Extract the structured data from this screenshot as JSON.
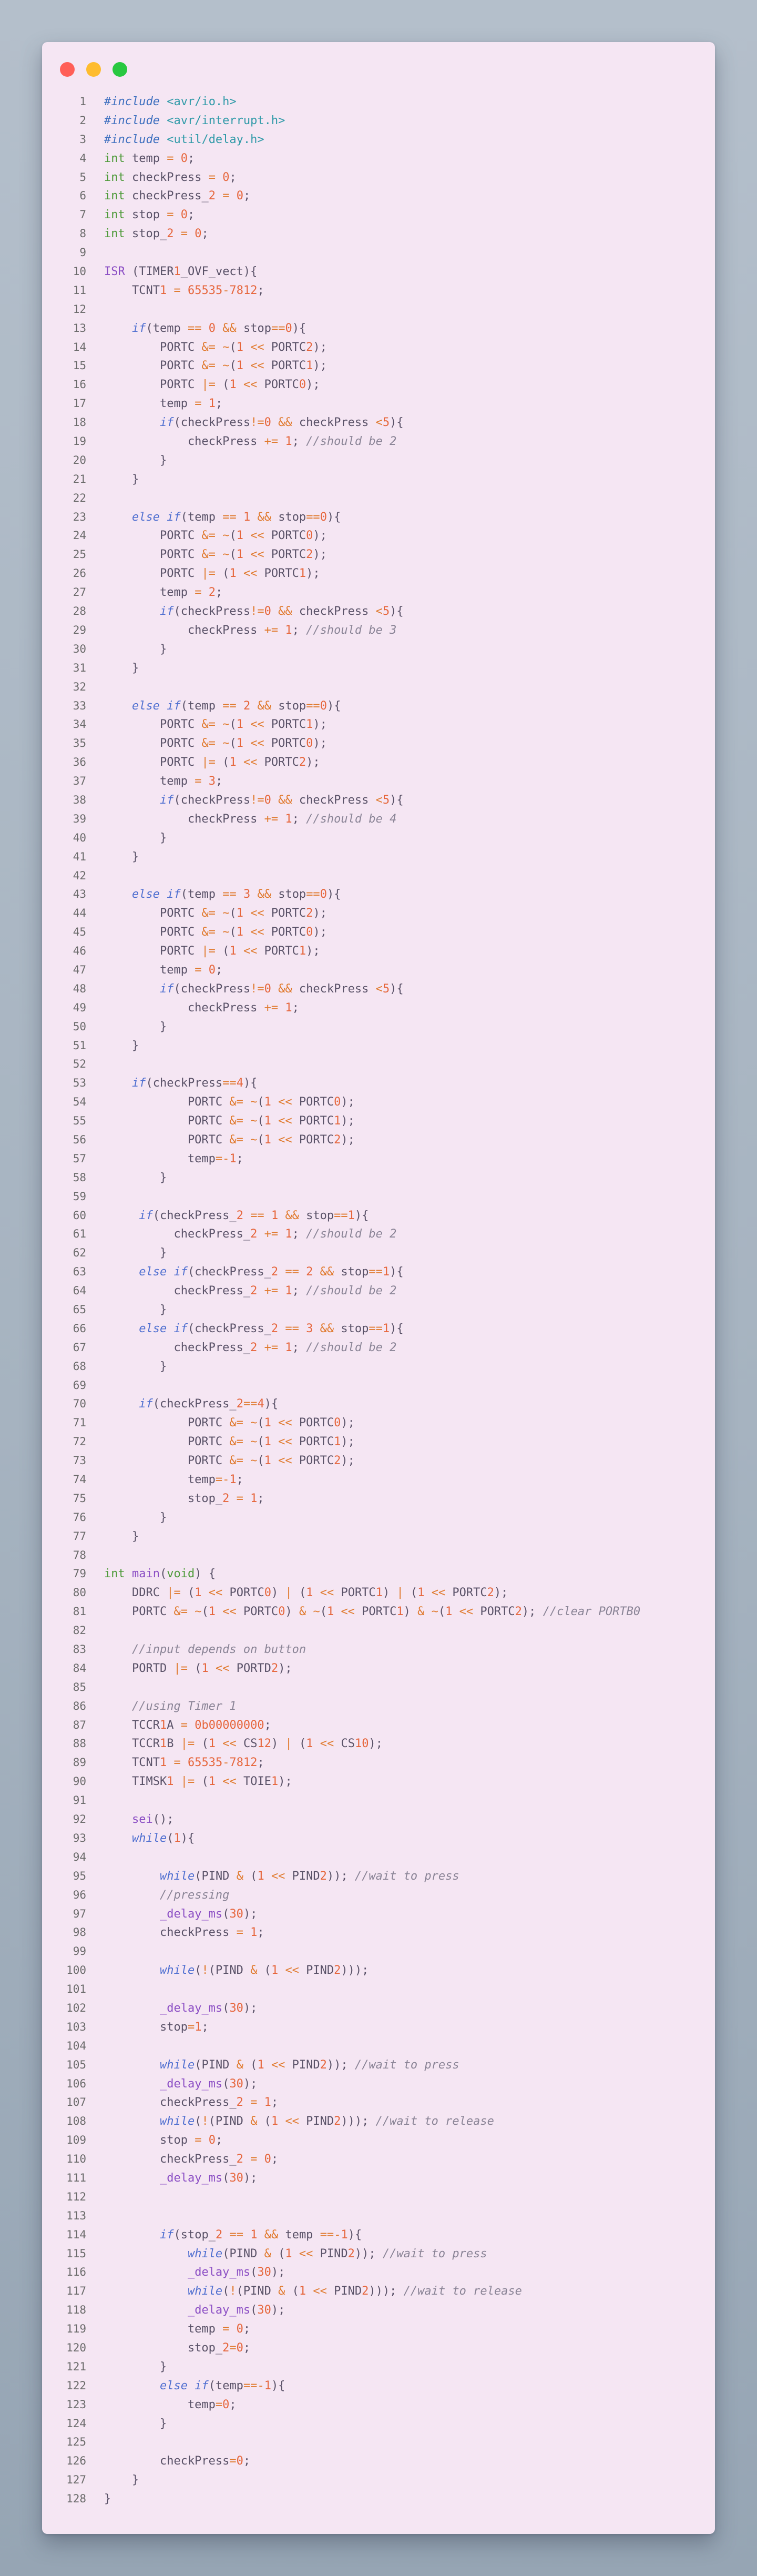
{
  "window": {
    "controls": [
      "close",
      "minimize",
      "maximize"
    ]
  },
  "code": {
    "lines": [
      "#include <avr/io.h>",
      "#include <avr/interrupt.h>",
      "#include <util/delay.h>",
      "int temp = 0;",
      "int checkPress = 0;",
      "int checkPress_2 = 0;",
      "int stop = 0;",
      "int stop_2 = 0;",
      "",
      "ISR (TIMER1_OVF_vect){",
      "    TCNT1 = 65535-7812;",
      "",
      "    if(temp == 0 && stop==0){",
      "        PORTC &= ~(1 << PORTC2);",
      "        PORTC &= ~(1 << PORTC1);",
      "        PORTC |= (1 << PORTC0);",
      "        temp = 1;",
      "        if(checkPress!=0 && checkPress <5){",
      "            checkPress += 1; //should be 2",
      "        }",
      "    }",
      "",
      "    else if(temp == 1 && stop==0){",
      "        PORTC &= ~(1 << PORTC0);",
      "        PORTC &= ~(1 << PORTC2);",
      "        PORTC |= (1 << PORTC1);",
      "        temp = 2;",
      "        if(checkPress!=0 && checkPress <5){",
      "            checkPress += 1; //should be 3",
      "        }",
      "    }",
      "",
      "    else if(temp == 2 && stop==0){",
      "        PORTC &= ~(1 << PORTC1);",
      "        PORTC &= ~(1 << PORTC0);",
      "        PORTC |= (1 << PORTC2);",
      "        temp = 3;",
      "        if(checkPress!=0 && checkPress <5){",
      "            checkPress += 1; //should be 4",
      "        }",
      "    }",
      "",
      "    else if(temp == 3 && stop==0){",
      "        PORTC &= ~(1 << PORTC2);",
      "        PORTC &= ~(1 << PORTC0);",
      "        PORTC |= (1 << PORTC1);",
      "        temp = 0;",
      "        if(checkPress!=0 && checkPress <5){",
      "            checkPress += 1;",
      "        }",
      "    }",
      "",
      "    if(checkPress==4){",
      "            PORTC &= ~(1 << PORTC0);",
      "            PORTC &= ~(1 << PORTC1);",
      "            PORTC &= ~(1 << PORTC2);",
      "            temp=-1;",
      "        }",
      "",
      "     if(checkPress_2 == 1 && stop==1){",
      "          checkPress_2 += 1; //should be 2",
      "        }",
      "     else if(checkPress_2 == 2 && stop==1){",
      "          checkPress_2 += 1; //should be 2",
      "        }",
      "     else if(checkPress_2 == 3 && stop==1){",
      "          checkPress_2 += 1; //should be 2",
      "        }",
      "",
      "     if(checkPress_2==4){",
      "            PORTC &= ~(1 << PORTC0);",
      "            PORTC &= ~(1 << PORTC1);",
      "            PORTC &= ~(1 << PORTC2);",
      "            temp=-1;",
      "            stop_2 = 1;",
      "        }",
      "    }",
      "",
      "int main(void) {",
      "    DDRC |= (1 << PORTC0) | (1 << PORTC1) | (1 << PORTC2);",
      "    PORTC &= ~(1 << PORTC0) & ~(1 << PORTC1) & ~(1 << PORTC2); //clear PORTB0",
      "",
      "    //input depends on button",
      "    PORTD |= (1 << PORTD2);",
      "",
      "    //using Timer 1",
      "    TCCR1A = 0b00000000;",
      "    TCCR1B |= (1 << CS12) | (1 << CS10);",
      "    TCNT1 = 65535-7812;",
      "    TIMSK1 |= (1 << TOIE1);",
      "",
      "    sei();",
      "    while(1){",
      "",
      "        while(PIND & (1 << PIND2)); //wait to press",
      "        //pressing",
      "        _delay_ms(30);",
      "        checkPress = 1;",
      "",
      "        while(!(PIND & (1 << PIND2)));",
      "",
      "        _delay_ms(30);",
      "        stop=1;",
      "",
      "        while(PIND & (1 << PIND2)); //wait to press",
      "        _delay_ms(30);",
      "        checkPress_2 = 1;",
      "        while(!(PIND & (1 << PIND2))); //wait to release",
      "        stop = 0;",
      "        checkPress_2 = 0;",
      "        _delay_ms(30);",
      "",
      "",
      "        if(stop_2 == 1 && temp ==-1){",
      "            while(PIND & (1 << PIND2)); //wait to press",
      "            _delay_ms(30);",
      "            while(!(PIND & (1 << PIND2))); //wait to release",
      "            _delay_ms(30);",
      "            temp = 0;",
      "            stop_2=0;",
      "        }",
      "        else if(temp==-1){",
      "            temp=0;",
      "        }",
      "",
      "        checkPress=0;",
      "    }",
      "}"
    ]
  }
}
